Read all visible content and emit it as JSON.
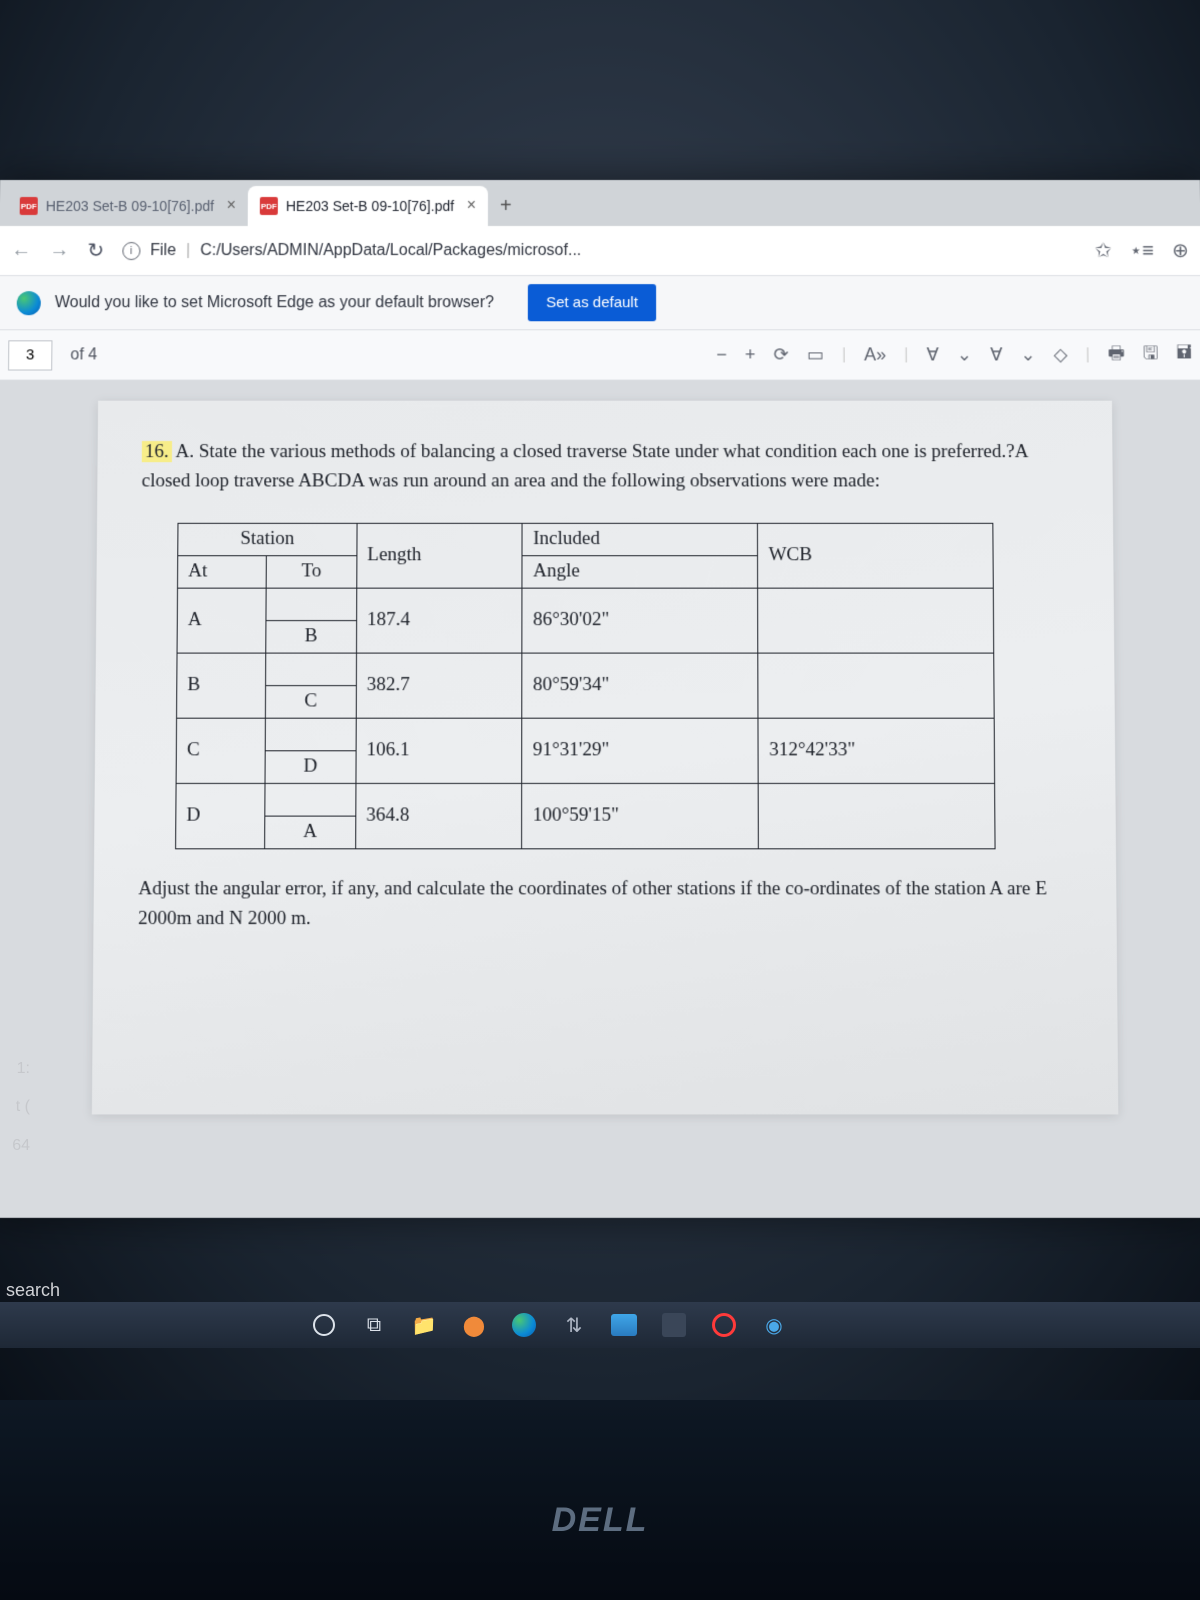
{
  "tabs": [
    {
      "title": "HE203 Set-B 09-10[76].pdf",
      "active": false
    },
    {
      "title": "HE203 Set-B 09-10[76].pdf",
      "active": true
    }
  ],
  "address": {
    "protocol_label": "File",
    "path": "C:/Users/ADMIN/AppData/Local/Packages/microsof..."
  },
  "infobar": {
    "message": "Would you like to set Microsoft Edge as your default browser?",
    "button": "Set as default"
  },
  "pdf_toolbar": {
    "page_current": "3",
    "page_total": "of 4",
    "read_aloud": "A»"
  },
  "document": {
    "question_number": "16.",
    "question_text_a": "A. State the various methods of balancing a closed traverse State under what condition each one is preferred.?A closed loop traverse ABCDA was run around an area and the following observations were made:",
    "table": {
      "headers": {
        "station": "Station",
        "at": "At",
        "to": "To",
        "length": "Length",
        "included": "Included",
        "angle": "Angle",
        "wcb": "WCB"
      },
      "rows": [
        {
          "at": "A",
          "to": "B",
          "length": "187.4",
          "angle": "86°30'02\"",
          "wcb": ""
        },
        {
          "at": "B",
          "to": "C",
          "length": "382.7",
          "angle": "80°59'34\"",
          "wcb": ""
        },
        {
          "at": "C",
          "to": "D",
          "length": "106.1",
          "angle": "91°31'29\"",
          "wcb": "312°42'33\""
        },
        {
          "at": "D",
          "to": "A",
          "length": "364.8",
          "angle": "100°59'15\"",
          "wcb": ""
        }
      ]
    },
    "closing_text": "Adjust the angular error, if any, and calculate the coordinates of other stations if the co-ordinates of the station A are E 2000m and N 2000 m."
  },
  "overlay": {
    "l1": "1:",
    "l2": "t (",
    "l3": "64",
    "search": "search"
  },
  "logo": "DELL"
}
